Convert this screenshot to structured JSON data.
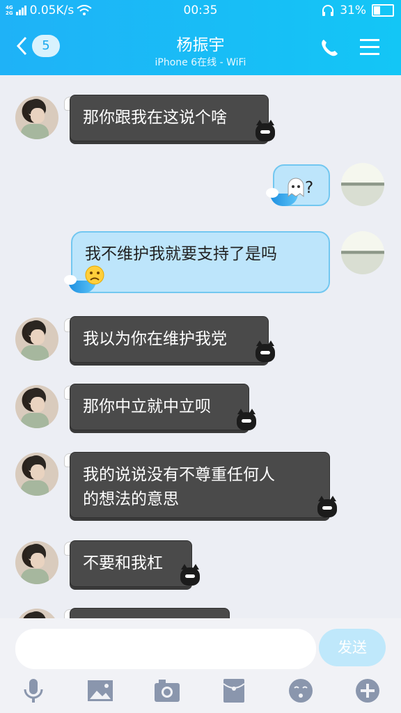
{
  "status": {
    "time": "00:35",
    "network_top": "4G",
    "network_bottom": "2G",
    "speed": "0.05K/s",
    "battery": "31%",
    "battery_level": 0.31
  },
  "header": {
    "back_badge": "5",
    "title": "杨振宇",
    "subtitle": "iPhone 6在线 - WiFi"
  },
  "messages": [
    {
      "side": "left",
      "text": "那你跟我在这说个啥"
    },
    {
      "side": "right",
      "text": "?"
    },
    {
      "side": "right",
      "text": "我不维护我就要支持了是吗"
    },
    {
      "side": "left",
      "text": "我以为你在维护我党"
    },
    {
      "side": "left",
      "text": "那你中立就中立呗"
    },
    {
      "side": "left",
      "lines": [
        "我的说说没有不尊重任何人",
        "的想法的意思"
      ]
    },
    {
      "side": "left",
      "text": "不要和我杠"
    }
  ],
  "input": {
    "placeholder": "",
    "send_label": "发送"
  },
  "toolbar": [
    "microphone-icon",
    "image-icon",
    "camera-icon",
    "red-packet-icon",
    "emoji-icon",
    "plus-icon"
  ],
  "colors": {
    "header": "#1fb2f7",
    "dark_bubble": "#4a4a4a",
    "blue_bubble": "#bde5fb",
    "send_button": "#bfe8fb"
  }
}
